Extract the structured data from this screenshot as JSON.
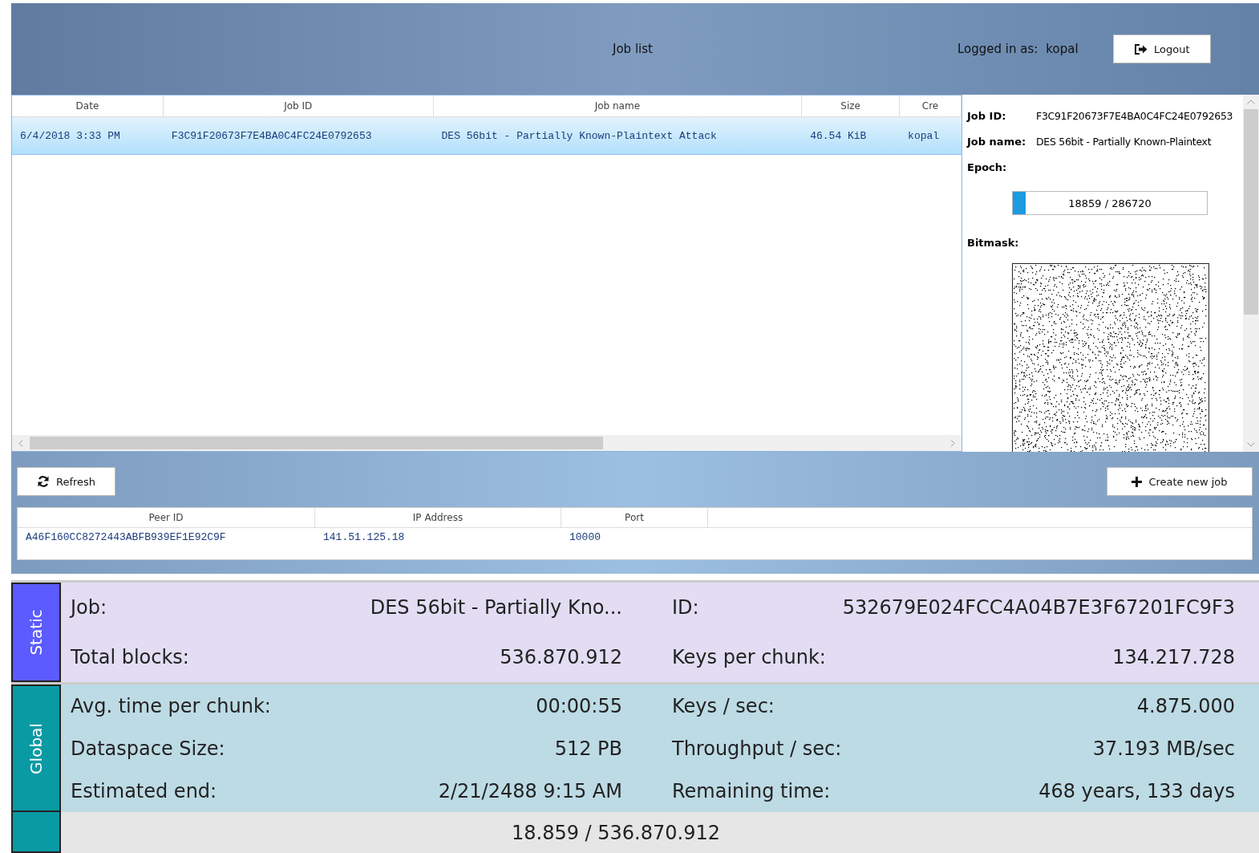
{
  "header": {
    "title": "Job list",
    "logged_in_label": "Logged in as:",
    "username": "kopal",
    "logout_button": "Logout"
  },
  "job_table": {
    "columns": [
      "Date",
      "Job ID",
      "Job name",
      "Size",
      "Cre"
    ],
    "rows": [
      {
        "selected": true,
        "cells": [
          "6/4/2018 3:33 PM",
          "F3C91F20673F7E4BA0C4FC24E0792653",
          "DES 56bit - Partially Known-Plaintext Attack",
          "46.54 KiB",
          "kopal"
        ]
      }
    ]
  },
  "details": {
    "job_id_label": "Job ID:",
    "job_id": "F3C91F20673F7E4BA0C4FC24E0792653",
    "job_name_label": "Job name:",
    "job_name": "DES 56bit - Partially Known-Plaintext",
    "epoch_label": "Epoch:",
    "epoch_progress": {
      "level": 0.066,
      "text": "18859 / 286720"
    },
    "bitmask_label": "Bitmask:"
  },
  "refresh_button": "Refresh",
  "create_button": "Create new job",
  "peer_table": {
    "columns": [
      "Peer ID",
      "IP Address",
      "Port"
    ],
    "rows": [
      {
        "selected": false,
        "cells": [
          "A46F160CC8272443ABFB939EF1E92C9F",
          "141.51.125.18",
          "10000"
        ]
      }
    ]
  },
  "stats": {
    "sections": [
      {
        "label": "Static",
        "color": "#5b5bff",
        "rows": [
          {
            "left_label": "Job:",
            "left_value": "DES 56bit - Partially Kno...",
            "right_label": "ID:",
            "right_value": "532679E024FCC4A04B7E3F67201FC9F3"
          },
          {
            "left_label": "Total blocks:",
            "left_value": "536.870.912",
            "right_label": "Keys per chunk:",
            "right_value": "134.217.728"
          }
        ]
      },
      {
        "label": "Global",
        "color": "#0a9aa4",
        "rows": [
          {
            "left_label": "Avg. time per chunk:",
            "left_value": "00:00:55",
            "right_label": "Keys / sec:",
            "right_value": "4.875.000"
          },
          {
            "left_label": "Dataspace Size:",
            "left_value": "512 PB",
            "right_label": "Throughput / sec:",
            "right_value": "37.193 MB/sec"
          },
          {
            "left_label": "Estimated end:",
            "left_value": "2/21/2488 9:15 AM",
            "right_label": "Remaining time:",
            "right_value": "468 years, 133 days"
          }
        ]
      }
    ],
    "progress": {
      "level": 3.51e-05,
      "text": "18.859 / 536.870.912"
    }
  }
}
